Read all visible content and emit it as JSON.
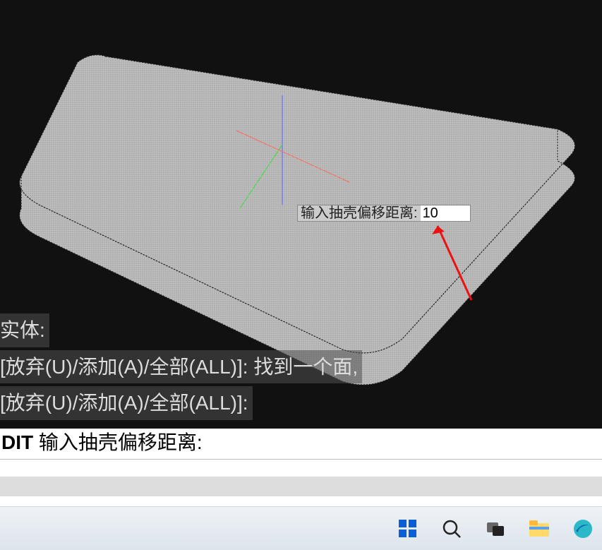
{
  "tooltip": {
    "label": "输入抽壳偏移距离:",
    "value": "10"
  },
  "console": {
    "line1_partial": "实体:",
    "line2": "[放弃(U)/添加(A)/全部(ALL)]:  找到一个面,",
    "line3": "[放弃(U)/添加(A)/全部(ALL)]:"
  },
  "cmdline": {
    "prefix": "DIT",
    "prompt": " 输入抽壳偏移距离:"
  },
  "taskbar_icons": [
    "start",
    "search",
    "taskview",
    "explorer",
    "edge"
  ]
}
